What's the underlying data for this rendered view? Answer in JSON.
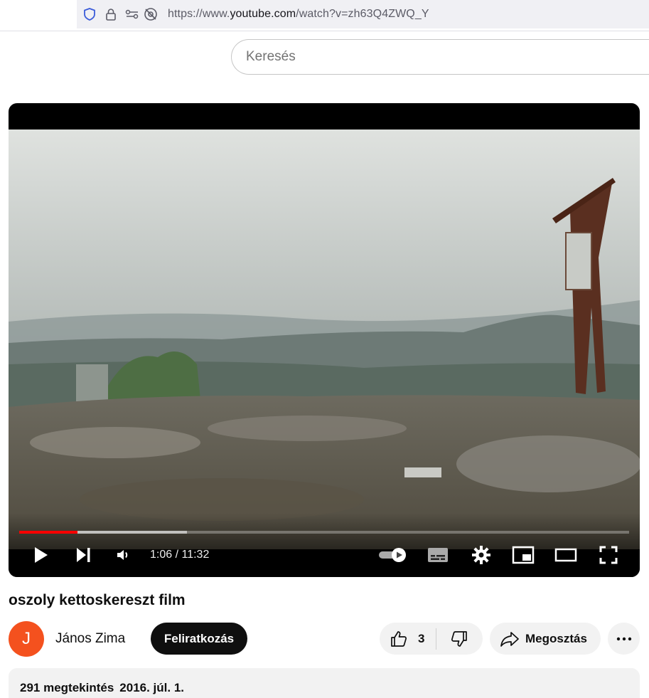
{
  "browser": {
    "url_prefix": "https://www.",
    "url_domain": "youtube.com",
    "url_rest": "/watch?v=zh63Q4ZWQ_Y"
  },
  "search": {
    "placeholder": "Keresés"
  },
  "player": {
    "current_time": "1:06",
    "separator": "/",
    "duration": "11:32",
    "played_fraction": 0.096,
    "buffered_fraction": 0.275,
    "accent_color": "#ff0000"
  },
  "video": {
    "title": "oszoly kettoskereszt film",
    "channel_name": "János Zima",
    "channel_initial": "J",
    "avatar_color": "#f4511e",
    "subscribe_label": "Feliratkozás",
    "like_count": "3",
    "share_label": "Megosztás"
  },
  "description": {
    "views": "291 megtekintés",
    "date": "2016. júl. 1."
  },
  "icons": [
    "shield-icon",
    "lock-icon",
    "permissions-icon",
    "tracking-off-icon",
    "play-icon",
    "next-icon",
    "volume-icon",
    "autoplay-toggle",
    "subtitles-icon",
    "settings-gear-icon",
    "miniplayer-icon",
    "theater-mode-icon",
    "fullscreen-icon",
    "thumbs-up-icon",
    "thumbs-down-icon",
    "share-arrow-icon",
    "more-dots-icon"
  ]
}
